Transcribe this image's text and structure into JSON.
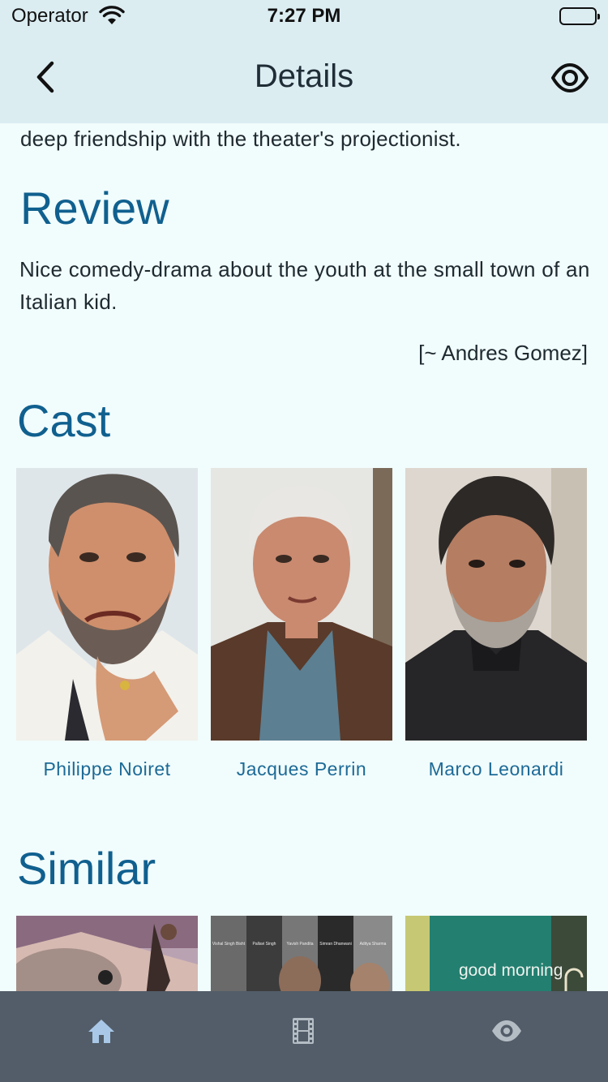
{
  "status": {
    "carrier": "Operator",
    "time": "7:27 PM"
  },
  "nav": {
    "title": "Details",
    "icons": {
      "back": "chevron-left-icon",
      "watch": "eye-icon"
    }
  },
  "synopsis_tail": "deep friendship with the theater's projectionist.",
  "review": {
    "heading": "Review",
    "text": "Nice comedy-drama about the youth at the small town of an Italian kid.",
    "author": "[~ Andres Gomez]"
  },
  "cast": {
    "heading": "Cast",
    "members": [
      {
        "name": "Philippe Noiret"
      },
      {
        "name": "Jacques Perrin"
      },
      {
        "name": "Marco Leonardi"
      }
    ]
  },
  "similar": {
    "heading": "Similar",
    "poster_names": [
      "Vishal Singh Bisht",
      "Pallavi Singh",
      "Yavish Pandita",
      "Simran Dhanwani",
      "Aditya Sharma"
    ],
    "poster3_text": "good morning"
  },
  "tabbar": {
    "tabs": [
      {
        "icon": "home-icon",
        "selected": true
      },
      {
        "icon": "film-icon",
        "selected": false
      },
      {
        "icon": "eye-icon",
        "selected": false
      }
    ],
    "colors": {
      "background": "#525d69",
      "selected": "#a9c8e8",
      "unselected": "#b4bcc4"
    }
  },
  "colors": {
    "accent": "#10608f",
    "header": "#dcedf2",
    "page": "#f1fcfc"
  }
}
